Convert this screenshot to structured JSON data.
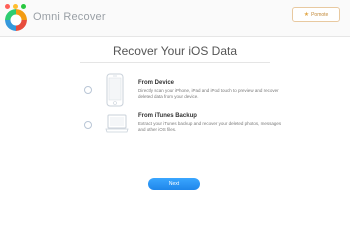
{
  "window": {
    "traffic_lights": [
      "#ff5f57",
      "#ffbd2e",
      "#28c840"
    ]
  },
  "header": {
    "app_name": "Omni Recover",
    "logo_icon": "omni-recover-logo",
    "promo_label": "Pomote",
    "promo_icon": "star-icon"
  },
  "main": {
    "title": "Recover Your iOS Data",
    "options": [
      {
        "title": "From Device",
        "description": "Directly scan your iPhone, iPad and iPod touch to preview and recover deleted data from your device.",
        "icon": "iphone-icon",
        "selected": false
      },
      {
        "title": "From iTunes Backup",
        "description": "Extract your iTunes backup and recover your deleted photos, messages and other iOS files.",
        "icon": "laptop-icon",
        "selected": false
      }
    ],
    "next_label": "Next"
  },
  "colors": {
    "accent": "#1f86ea",
    "promo_border": "#e8c9a0"
  }
}
